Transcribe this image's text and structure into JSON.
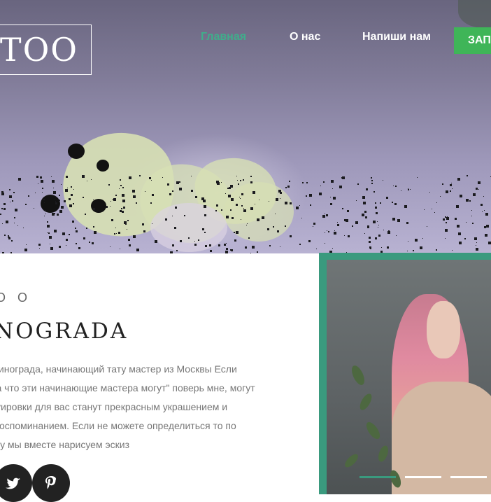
{
  "logo": {
    "text": "TOO"
  },
  "nav": {
    "items": [
      {
        "label": "Главная",
        "active": true
      },
      {
        "label": "О нас",
        "active": false
      },
      {
        "label": "Напиши нам",
        "active": false
      }
    ],
    "cta_label": "ЗАП"
  },
  "about": {
    "subtitle": "O O",
    "heading": "NOGRADA",
    "description_lines": [
      "- Винограда, начинающий тату мастер из Москвы Если",
      "\"Да что эти начинающие мастера могут\" поверь мне, могут",
      "атуировки для вас станут прекрасным украшением и",
      "и воспоминанием. Если не можете определиться то по",
      "кусу мы вместе нарисуем эскиз"
    ],
    "social_icons": [
      "twitter-icon",
      "pinterest-icon"
    ]
  },
  "slider": {
    "slide_count": 3,
    "active_index": 0
  },
  "colors": {
    "accent": "#3a9a7e",
    "nav_active": "#3fae8b",
    "cta": "#3fb558",
    "heading": "#222222",
    "text": "#777777"
  }
}
